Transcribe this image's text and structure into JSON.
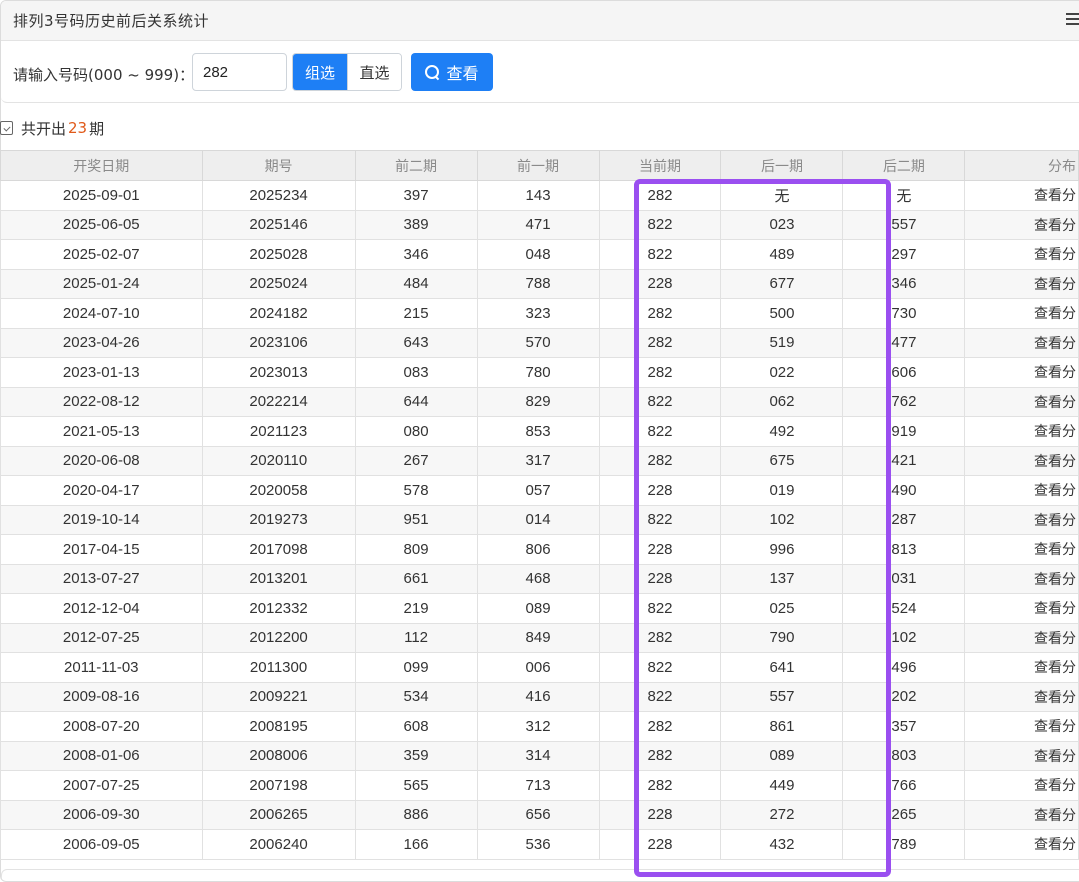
{
  "header": {
    "title": "排列3号码历史前后关系统计"
  },
  "search": {
    "label": "请输入号码(000 ~ 999)：",
    "value": "282",
    "mode_group": "组选",
    "mode_direct": "直选",
    "query_label": "查看"
  },
  "summary": {
    "prefix": "共开出",
    "count": "23",
    "suffix": "期"
  },
  "table": {
    "columns": [
      "开奖日期",
      "期号",
      "前二期",
      "前一期",
      "当前期",
      "后一期",
      "后二期",
      "分布"
    ],
    "action_label": "查看分",
    "rows": [
      [
        "2025-09-01",
        "2025234",
        "397",
        "143",
        "282",
        "无",
        "无"
      ],
      [
        "2025-06-05",
        "2025146",
        "389",
        "471",
        "822",
        "023",
        "557"
      ],
      [
        "2025-02-07",
        "2025028",
        "346",
        "048",
        "822",
        "489",
        "297"
      ],
      [
        "2025-01-24",
        "2025024",
        "484",
        "788",
        "228",
        "677",
        "346"
      ],
      [
        "2024-07-10",
        "2024182",
        "215",
        "323",
        "282",
        "500",
        "730"
      ],
      [
        "2023-04-26",
        "2023106",
        "643",
        "570",
        "282",
        "519",
        "477"
      ],
      [
        "2023-01-13",
        "2023013",
        "083",
        "780",
        "282",
        "022",
        "606"
      ],
      [
        "2022-08-12",
        "2022214",
        "644",
        "829",
        "822",
        "062",
        "762"
      ],
      [
        "2021-05-13",
        "2021123",
        "080",
        "853",
        "822",
        "492",
        "919"
      ],
      [
        "2020-06-08",
        "2020110",
        "267",
        "317",
        "282",
        "675",
        "421"
      ],
      [
        "2020-04-17",
        "2020058",
        "578",
        "057",
        "228",
        "019",
        "490"
      ],
      [
        "2019-10-14",
        "2019273",
        "951",
        "014",
        "822",
        "102",
        "287"
      ],
      [
        "2017-04-15",
        "2017098",
        "809",
        "806",
        "228",
        "996",
        "813"
      ],
      [
        "2013-07-27",
        "2013201",
        "661",
        "468",
        "228",
        "137",
        "031"
      ],
      [
        "2012-12-04",
        "2012332",
        "219",
        "089",
        "822",
        "025",
        "524"
      ],
      [
        "2012-07-25",
        "2012200",
        "112",
        "849",
        "282",
        "790",
        "102"
      ],
      [
        "2011-11-03",
        "2011300",
        "099",
        "006",
        "822",
        "641",
        "496"
      ],
      [
        "2009-08-16",
        "2009221",
        "534",
        "416",
        "822",
        "557",
        "202"
      ],
      [
        "2008-07-20",
        "2008195",
        "608",
        "312",
        "282",
        "861",
        "357"
      ],
      [
        "2008-01-06",
        "2008006",
        "359",
        "314",
        "282",
        "089",
        "803"
      ],
      [
        "2007-07-25",
        "2007198",
        "565",
        "713",
        "282",
        "449",
        "766"
      ],
      [
        "2006-09-30",
        "2006265",
        "886",
        "656",
        "228",
        "272",
        "265"
      ],
      [
        "2006-09-05",
        "2006240",
        "166",
        "536",
        "228",
        "432",
        "789"
      ]
    ]
  },
  "colors": {
    "accent": "#1e7ff5",
    "highlight": "#9a4ff0",
    "count_color": "#e05a1a"
  }
}
